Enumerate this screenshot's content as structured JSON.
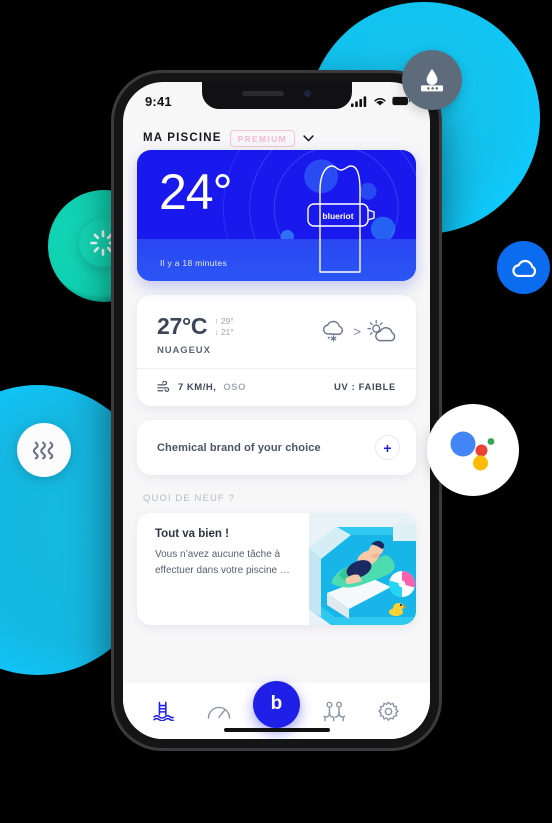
{
  "status_bar": {
    "time": "9:41",
    "icons": [
      "cellular-signal-icon",
      "wifi-icon",
      "battery-icon"
    ]
  },
  "header": {
    "title": "MA PISCINE",
    "badge": "PREMIUM",
    "chevron": "∨"
  },
  "pool_card": {
    "temperature": "24°",
    "device_label": "blueriot",
    "updated": "Il y a 18 minutes",
    "bg_color": "#1919ee",
    "band_color": "#2b56f5"
  },
  "weather_card": {
    "temperature": "27°C",
    "high": "↑ 29°",
    "low": "↓ 21°",
    "condition": "NUAGEUX",
    "icon_now": "cloud-snow-icon",
    "icon_separator": ">",
    "icon_next": "sun-behind-cloud-icon",
    "wind": "7 KM/H,",
    "wind_direction": "OSO",
    "wind_icon": "wind-icon",
    "uv": "UV : FAIBLE"
  },
  "brand_card": {
    "label": "Chemical brand of your choice",
    "add": "+"
  },
  "news": {
    "section_title": "QUOI DE NEUF ?",
    "card_title": "Tout va bien !",
    "card_body": "Vous n’avez aucune tâche à effectuer dans votre piscine …",
    "illustration": "person-floating-in-pool-illustration"
  },
  "tabbar": {
    "items": [
      {
        "name": "pool-ladder-icon",
        "active": true
      },
      {
        "name": "gauge-icon",
        "active": false
      },
      {
        "name": "logo-b-icon",
        "active": false
      },
      {
        "name": "community-icon",
        "active": false
      },
      {
        "name": "gear-icon",
        "active": false
      }
    ],
    "fab_label": "b",
    "accent_color": "#1f1fe8"
  },
  "floating_bubbles": [
    {
      "name": "ph-test-strip-icon",
      "color": "#5d6b7a"
    },
    {
      "name": "sun-icon",
      "color": "#0fd2b2"
    },
    {
      "name": "cloud-icon",
      "color": "#0b6cf0"
    },
    {
      "name": "heat-waves-icon",
      "color": "#ffffff"
    },
    {
      "name": "google-assistant-icon",
      "color": "#ffffff"
    }
  ]
}
